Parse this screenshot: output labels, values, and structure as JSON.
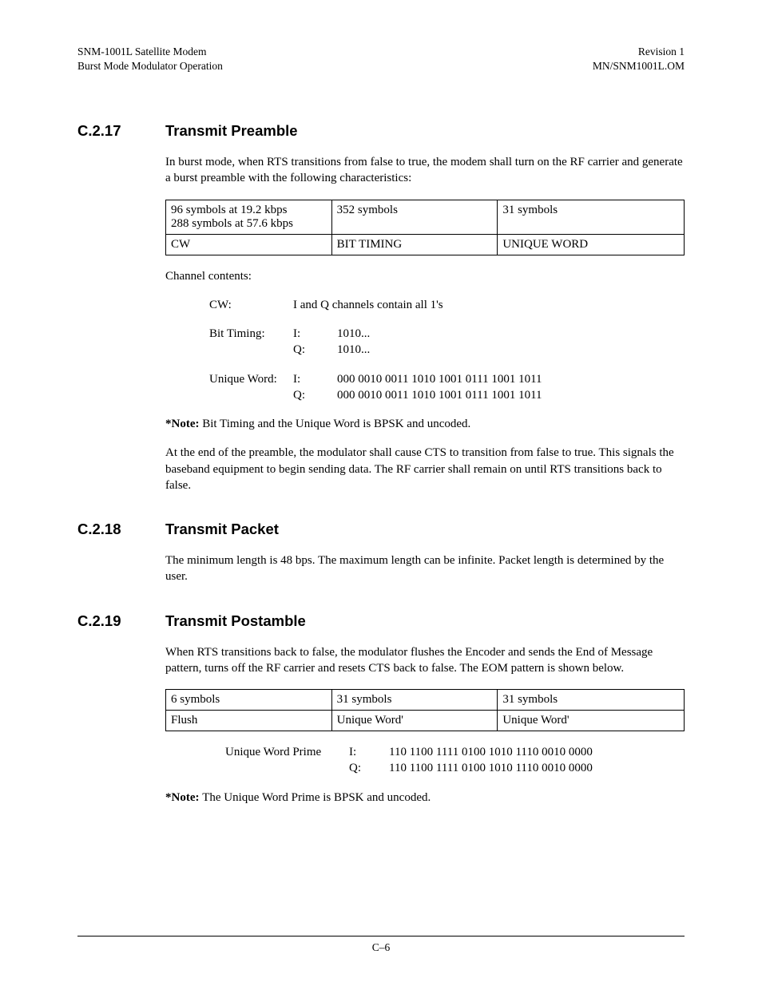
{
  "header": {
    "left1": "SNM-1001L Satellite Modem",
    "left2": "Burst Mode Modulator Operation",
    "right1": "Revision 1",
    "right2": "MN/SNM1001L.OM"
  },
  "s17": {
    "num": "C.2.17",
    "title": "Transmit Preamble",
    "intro": "In burst mode, when RTS transitions from false to true, the modem shall turn on the RF carrier and generate a burst preamble with the following characteristics:",
    "table": {
      "r1c1a": "96 symbols at 19.2 kbps",
      "r1c1b": "288 symbols at 57.6 kbps",
      "r1c2": "352 symbols",
      "r1c3": "31 symbols",
      "r2c1": "CW",
      "r2c2": "BIT TIMING",
      "r2c3": "UNIQUE WORD"
    },
    "chanLabel": "Channel contents:",
    "cw": {
      "label": "CW:",
      "val": "I and Q channels contain all 1's"
    },
    "bt": {
      "label": "Bit Timing:",
      "i": "I:",
      "ival": "1010...",
      "q": "Q:",
      "qval": "1010..."
    },
    "uw": {
      "label": "Unique Word:",
      "i": "I:",
      "ival": "000 0010 0011 1010 1001 0111 1001 1011",
      "q": "Q:",
      "qval": "000 0010 0011 1010 1001 0111 1001 1011"
    },
    "noteLabel": "*Note: ",
    "noteBody": "Bit Timing and the Unique Word is BPSK and uncoded.",
    "outro": "At the end of the preamble, the modulator shall cause CTS to transition from false to true. This signals the baseband equipment to begin sending data. The RF carrier shall remain on until RTS transitions back to false."
  },
  "s18": {
    "num": "C.2.18",
    "title": "Transmit Packet",
    "body": "The minimum length is 48 bps. The maximum length can be infinite. Packet length is determined by the user."
  },
  "s19": {
    "num": "C.2.19",
    "title": "Transmit Postamble",
    "intro": "When RTS transitions back to false, the modulator flushes the Encoder and sends the End of Message pattern, turns off the RF carrier and resets CTS back to false. The EOM pattern is shown below.",
    "table": {
      "r1c1": "6 symbols",
      "r1c2": "31 symbols",
      "r1c3": "31 symbols",
      "r2c1": "Flush",
      "r2c2": "Unique Word'",
      "r2c3": "Unique Word'"
    },
    "uwp": {
      "label": "Unique Word Prime",
      "i": "I:",
      "ival": "110 1100 1111 0100 1010 1110 0010 0000",
      "q": "Q:",
      "qval": "110 1100 1111 0100 1010 1110 0010 0000"
    },
    "noteLabel": "*Note: ",
    "noteBody": "The Unique Word Prime is BPSK and uncoded."
  },
  "footer": "C–6"
}
